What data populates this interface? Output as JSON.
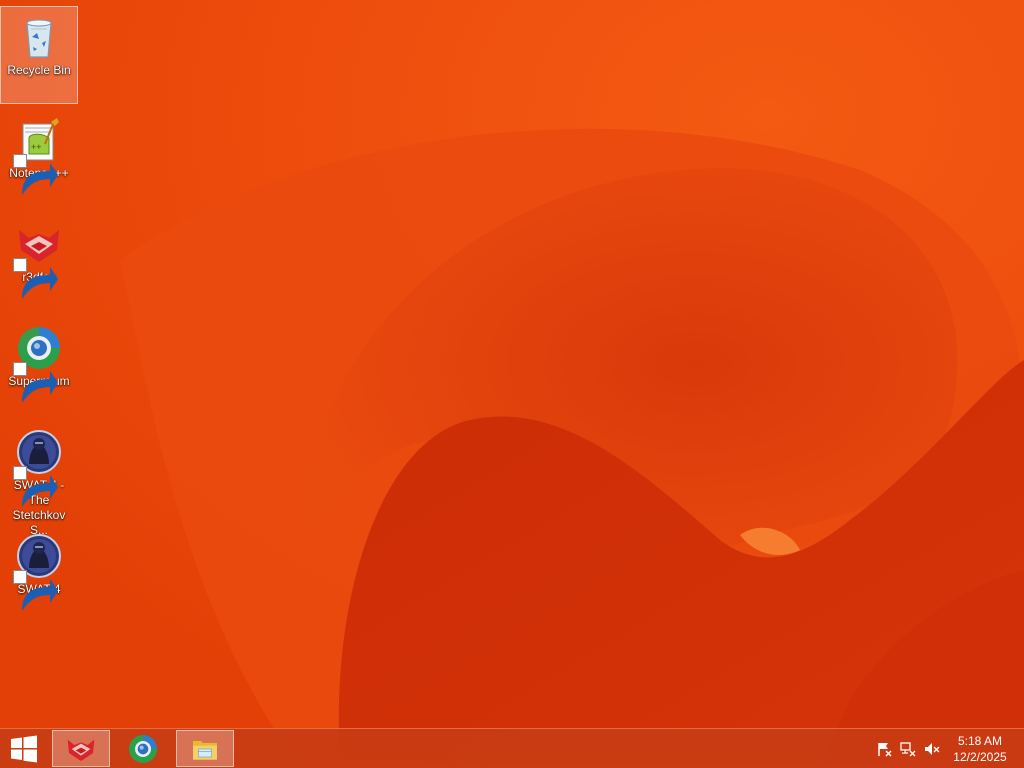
{
  "desktop": {
    "icons": [
      {
        "label": "Recycle Bin",
        "icon": "recycle-bin-icon",
        "shortcut": false,
        "selected": true
      },
      {
        "label": "Notepad++",
        "icon": "notepadpp-icon",
        "shortcut": true,
        "selected": false
      },
      {
        "label": "r3dfox",
        "icon": "r3dfox-icon",
        "shortcut": true,
        "selected": false
      },
      {
        "label": "Supermium",
        "icon": "supermium-icon",
        "shortcut": true,
        "selected": false
      },
      {
        "label": "SWAT 4 - The Stetchkov S...",
        "icon": "swat4-icon",
        "shortcut": true,
        "selected": false
      },
      {
        "label": "SWAT 4",
        "icon": "swat4-icon",
        "shortcut": true,
        "selected": false
      }
    ]
  },
  "taskbar": {
    "start_icon": "windows-logo-icon",
    "pinned": [
      {
        "name": "r3dfox",
        "icon": "r3dfox-icon",
        "active": true
      },
      {
        "name": "Supermium",
        "icon": "supermium-icon",
        "active": false
      },
      {
        "name": "File Explorer",
        "icon": "file-explorer-icon",
        "active": true
      }
    ],
    "tray": {
      "icons": [
        "action-center-flag-icon",
        "network-icon",
        "volume-muted-icon"
      ],
      "time": "5:18 AM",
      "date": "12/2/2025"
    }
  },
  "colors": {
    "wallpaper_base": "#e8480e",
    "wallpaper_dark": "#c42a06",
    "taskbar": "#c83c14"
  }
}
